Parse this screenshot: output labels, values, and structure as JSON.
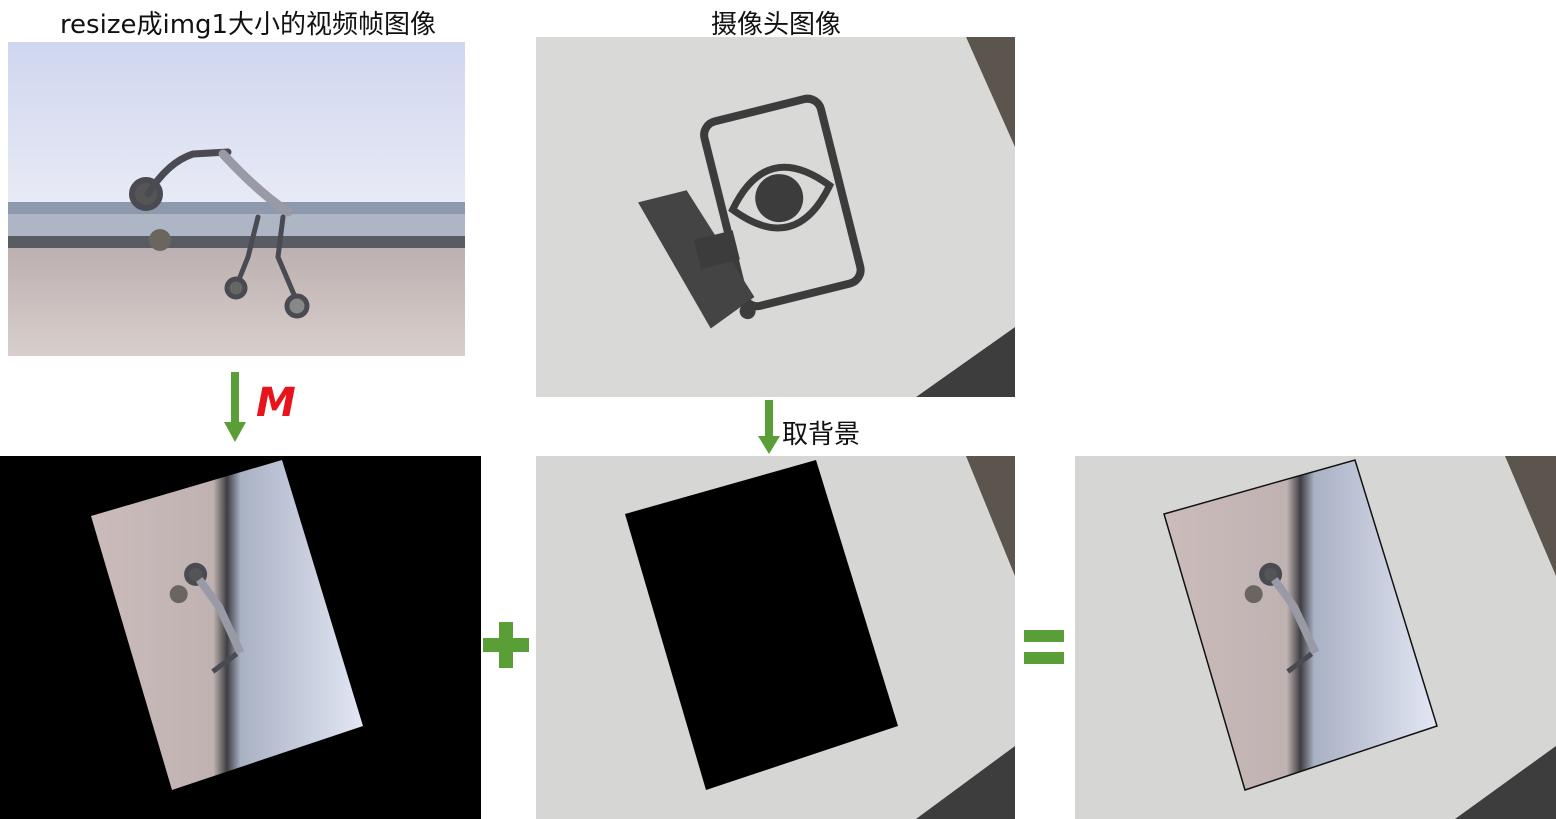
{
  "captions": {
    "video_frame": "resize成img1大小的视频帧图像",
    "camera_image": "摄像头图像"
  },
  "operations": {
    "transform_matrix": "M",
    "take_background": "取背景",
    "plus_sign": "+",
    "equals_sign": "="
  },
  "colors": {
    "arrow_green": "#5a9e37",
    "matrix_red": "#e8141b",
    "background": "#ffffff",
    "black_fill": "#000000"
  },
  "icons": [
    "down-arrow-icon",
    "plus-icon",
    "equals-icon",
    "surveillance-camera-eye-icon"
  ]
}
